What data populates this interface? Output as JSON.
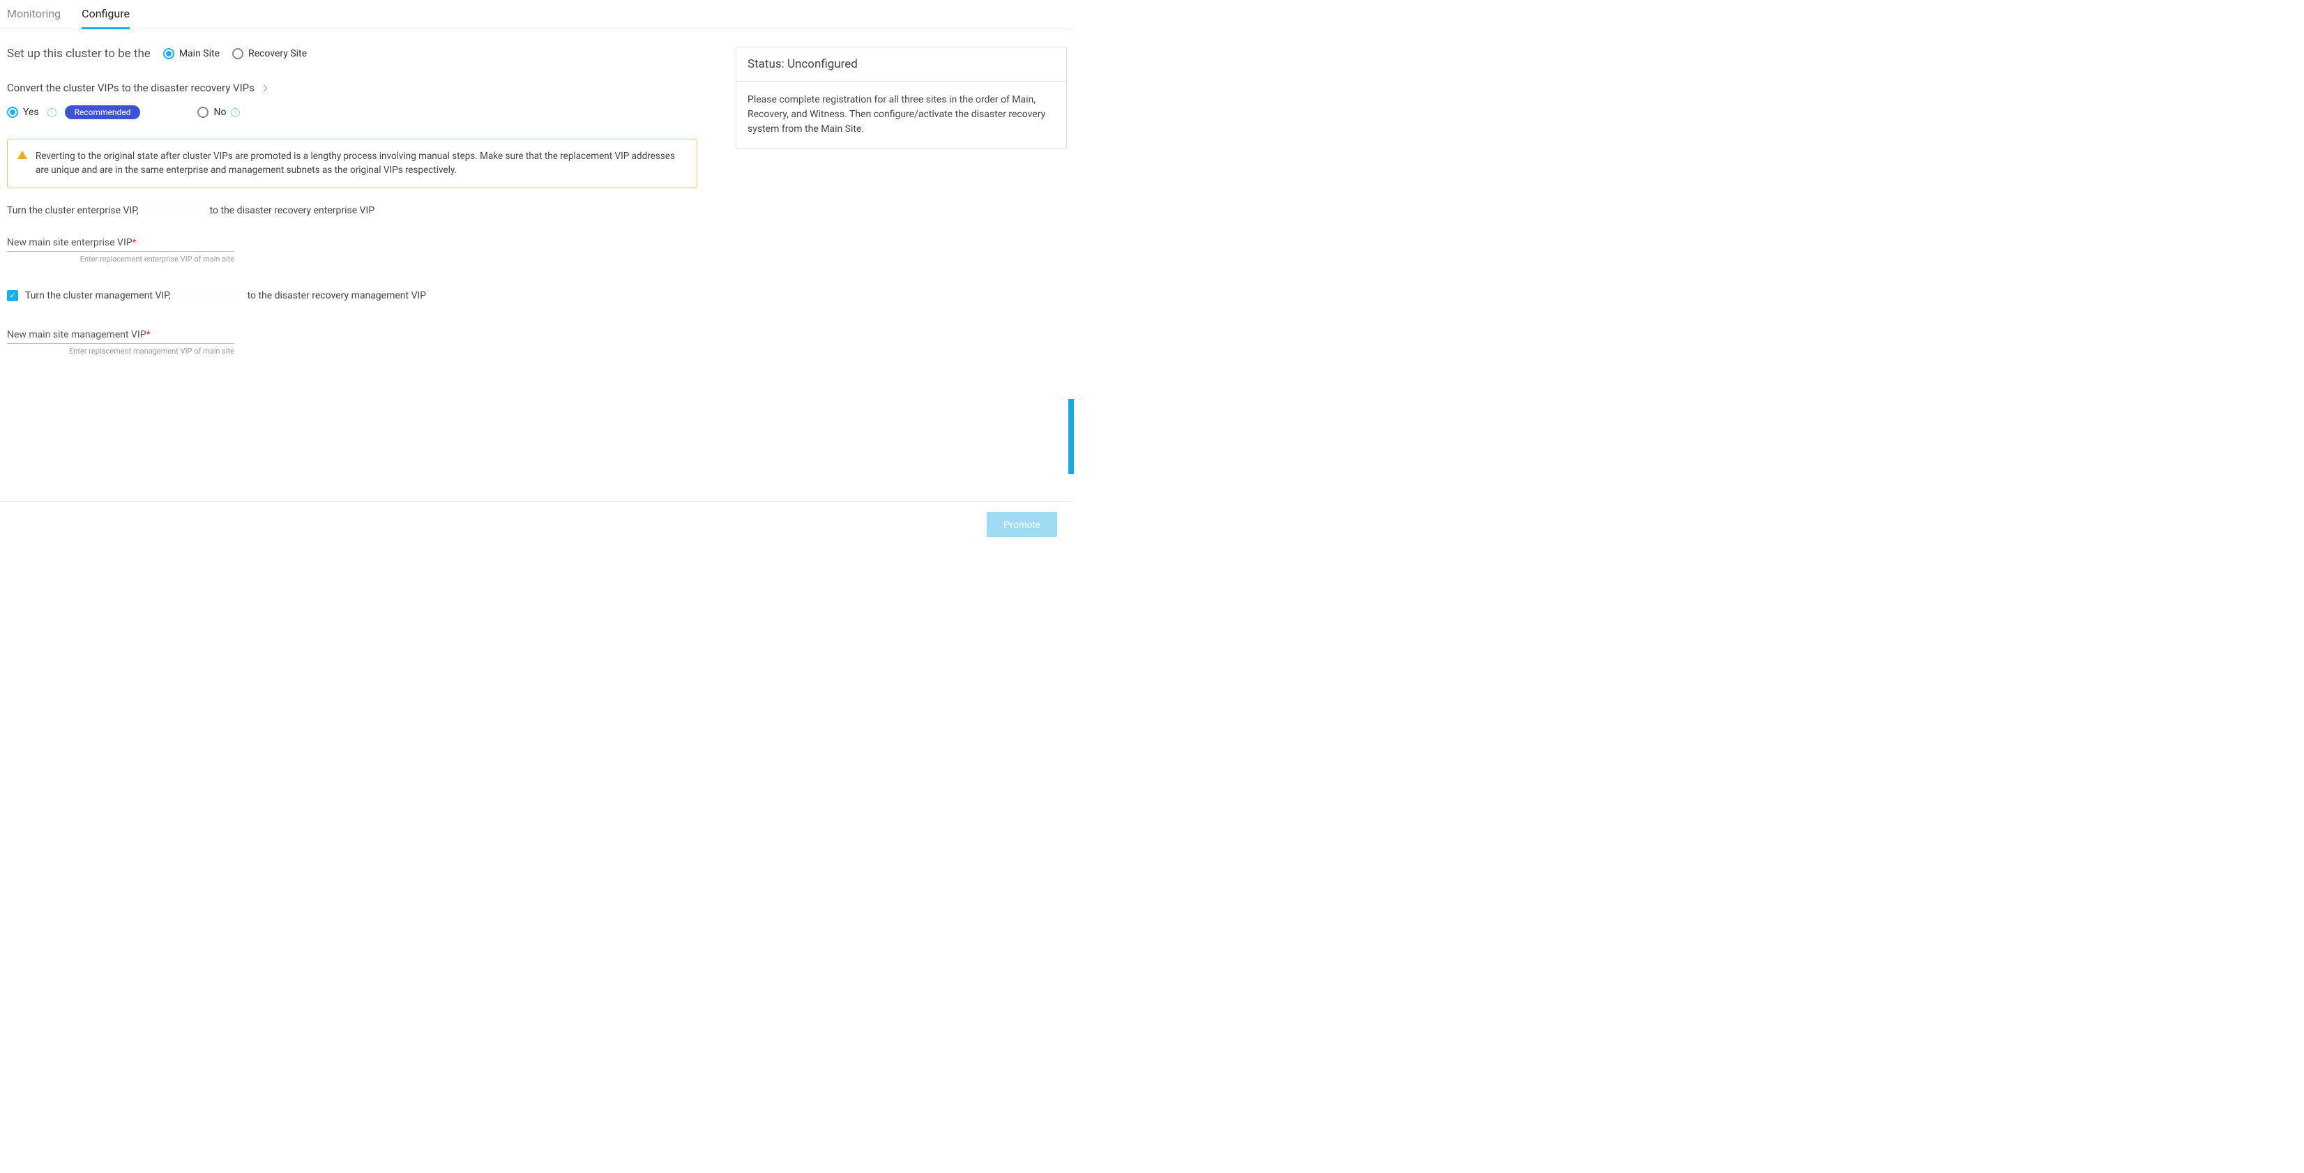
{
  "tabs": {
    "monitoring": "Monitoring",
    "configure": "Configure"
  },
  "setup": {
    "label": "Set up this cluster to be the",
    "main_site": "Main Site",
    "recovery_site": "Recovery Site"
  },
  "convert": {
    "title": "Convert the cluster VIPs to the disaster recovery VIPs",
    "yes": "Yes",
    "no": "No",
    "recommended": "Recommended"
  },
  "alert": {
    "text": "Reverting to the original state after cluster VIPs are promoted is a lengthy process involving manual steps. Make sure that the replacement VIP addresses are unique and are in the same enterprise and management subnets as the original VIPs respectively."
  },
  "enterprise": {
    "line_pre": "Turn the cluster enterprise VIP,",
    "line_post": "to the disaster recovery enterprise VIP",
    "field_label": "New main site enterprise VIP",
    "field_help": "Enter replacement enterprise VIP of main site"
  },
  "management": {
    "line_pre": "Turn the cluster management VIP,",
    "line_post": "to the disaster recovery management VIP",
    "field_label": "New main site management VIP",
    "field_help": "Enter replacement management VIP of main site"
  },
  "status": {
    "header": "Status: Unconfigured",
    "body": "Please complete registration for all three sites in the order of Main, Recovery, and Witness. Then configure/activate the disaster recovery system from the Main Site."
  },
  "footer": {
    "promote": "Promote"
  }
}
